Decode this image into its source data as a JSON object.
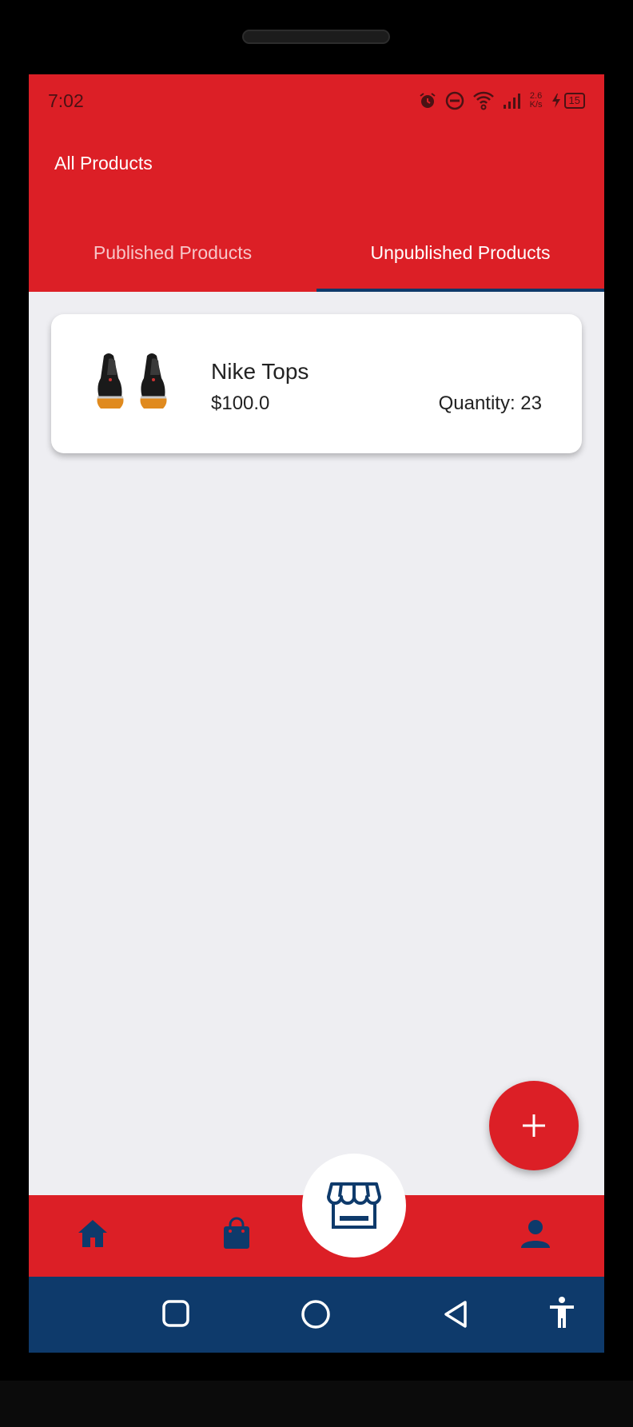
{
  "status_bar": {
    "time": "7:02",
    "net_speed_value": "2.6",
    "net_speed_unit": "K/s",
    "battery": "15"
  },
  "app_bar": {
    "title": "All Products"
  },
  "tabs": [
    {
      "label": "Published Products",
      "active": false
    },
    {
      "label": "Unpublished Products",
      "active": true
    }
  ],
  "products": [
    {
      "name": "Nike Tops",
      "price": "$100.0",
      "quantity_label": "Quantity:",
      "quantity": "23"
    }
  ],
  "fab": {
    "icon": "plus-icon"
  },
  "bottom_nav": {
    "items": [
      "home-icon",
      "shopping-bag-icon",
      "store-icon",
      "person-icon"
    ]
  },
  "system_nav": {
    "items": [
      "recents-icon",
      "home-circle-icon",
      "back-icon",
      "accessibility-icon"
    ]
  },
  "colors": {
    "primary": "#dc1f26",
    "navy": "#0e3a6b",
    "background": "#eeeef2"
  }
}
